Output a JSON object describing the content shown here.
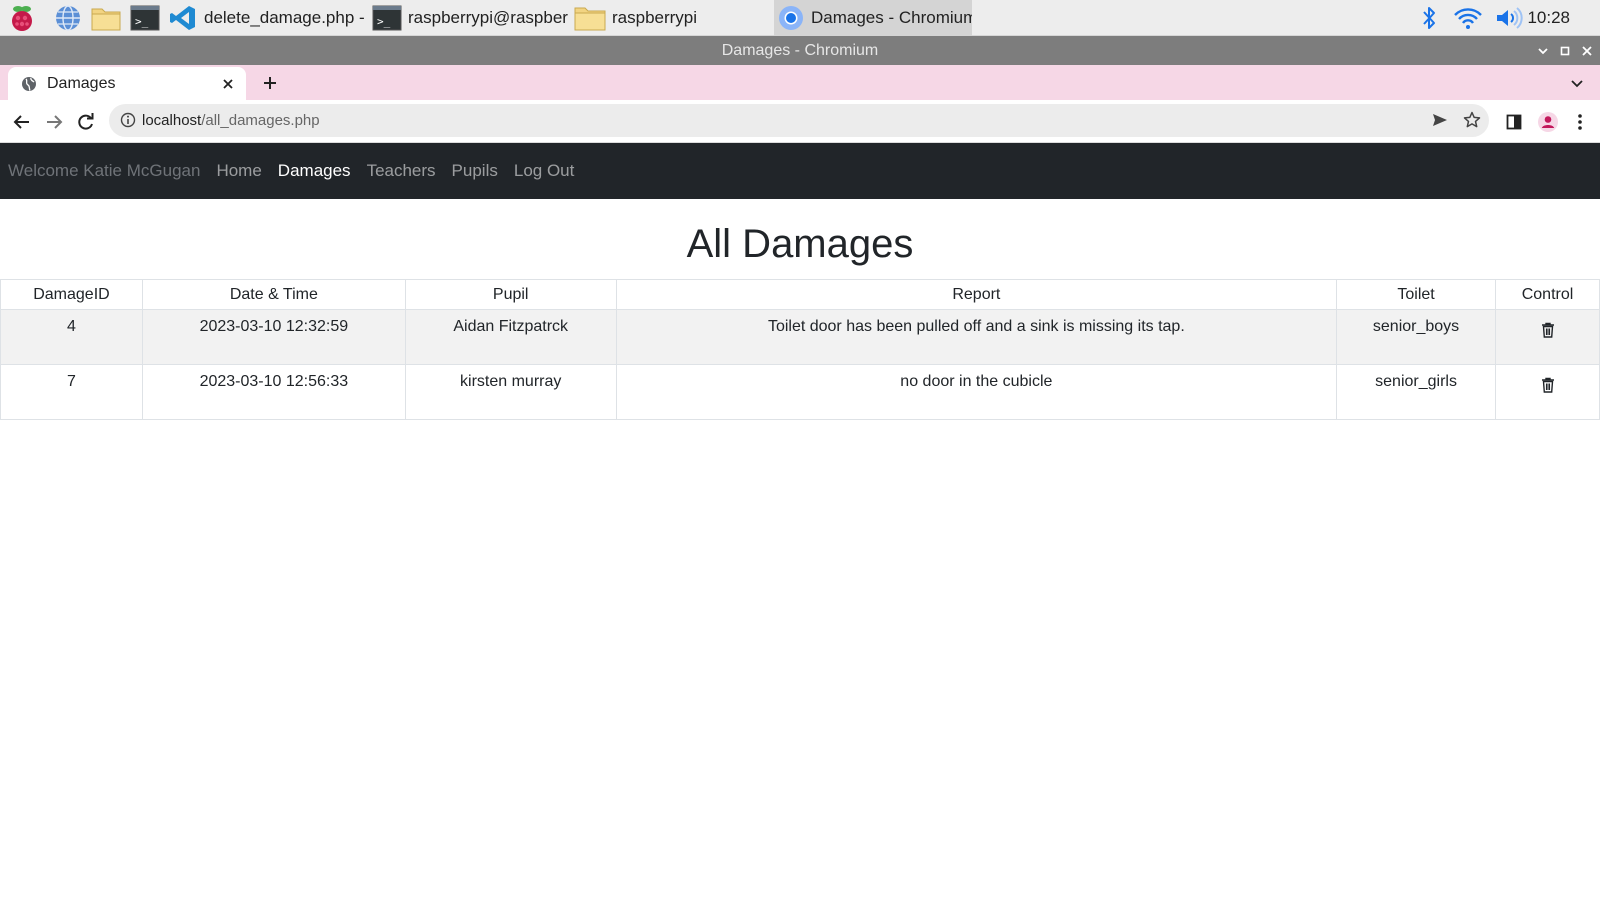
{
  "taskbar": {
    "tasks": [
      {
        "label": "delete_damage.php - ...",
        "icon": "vscode-icon"
      },
      {
        "label": "raspberrypi@raspber...",
        "icon": "terminal-icon"
      },
      {
        "label": "raspberrypi",
        "icon": "folder-icon"
      },
      {
        "label": "Damages - Chromium",
        "icon": "chromium-icon",
        "active": true
      }
    ],
    "clock": "10:28"
  },
  "window": {
    "title": "Damages - Chromium"
  },
  "browser": {
    "tab_title": "Damages",
    "url_host": "localhost",
    "url_path": "/all_damages.php"
  },
  "site": {
    "welcome": "Welcome Katie McGugan",
    "nav": [
      {
        "label": "Home",
        "active": false
      },
      {
        "label": "Damages",
        "active": true
      },
      {
        "label": "Teachers",
        "active": false
      },
      {
        "label": "Pupils",
        "active": false
      },
      {
        "label": "Log Out",
        "active": false
      }
    ],
    "title": "All Damages",
    "table": {
      "headers": [
        "DamageID",
        "Date & Time",
        "Pupil",
        "Report",
        "Toilet",
        "Control"
      ],
      "rows": [
        {
          "id": "4",
          "datetime": "2023-03-10 12:32:59",
          "pupil": "Aidan Fitzpatrck",
          "report": "Toilet door has been pulled off and a sink is missing its tap.",
          "toilet": "senior_boys"
        },
        {
          "id": "7",
          "datetime": "2023-03-10 12:56:33",
          "pupil": "kirsten murray",
          "report": "no door in the cubicle",
          "toilet": "senior_girls"
        }
      ]
    }
  },
  "colors": {
    "navbar": "#212529",
    "tabstrip": "#f6d7e6",
    "window_title": "#7d7d7d",
    "striped_row": "#f2f2f2"
  }
}
